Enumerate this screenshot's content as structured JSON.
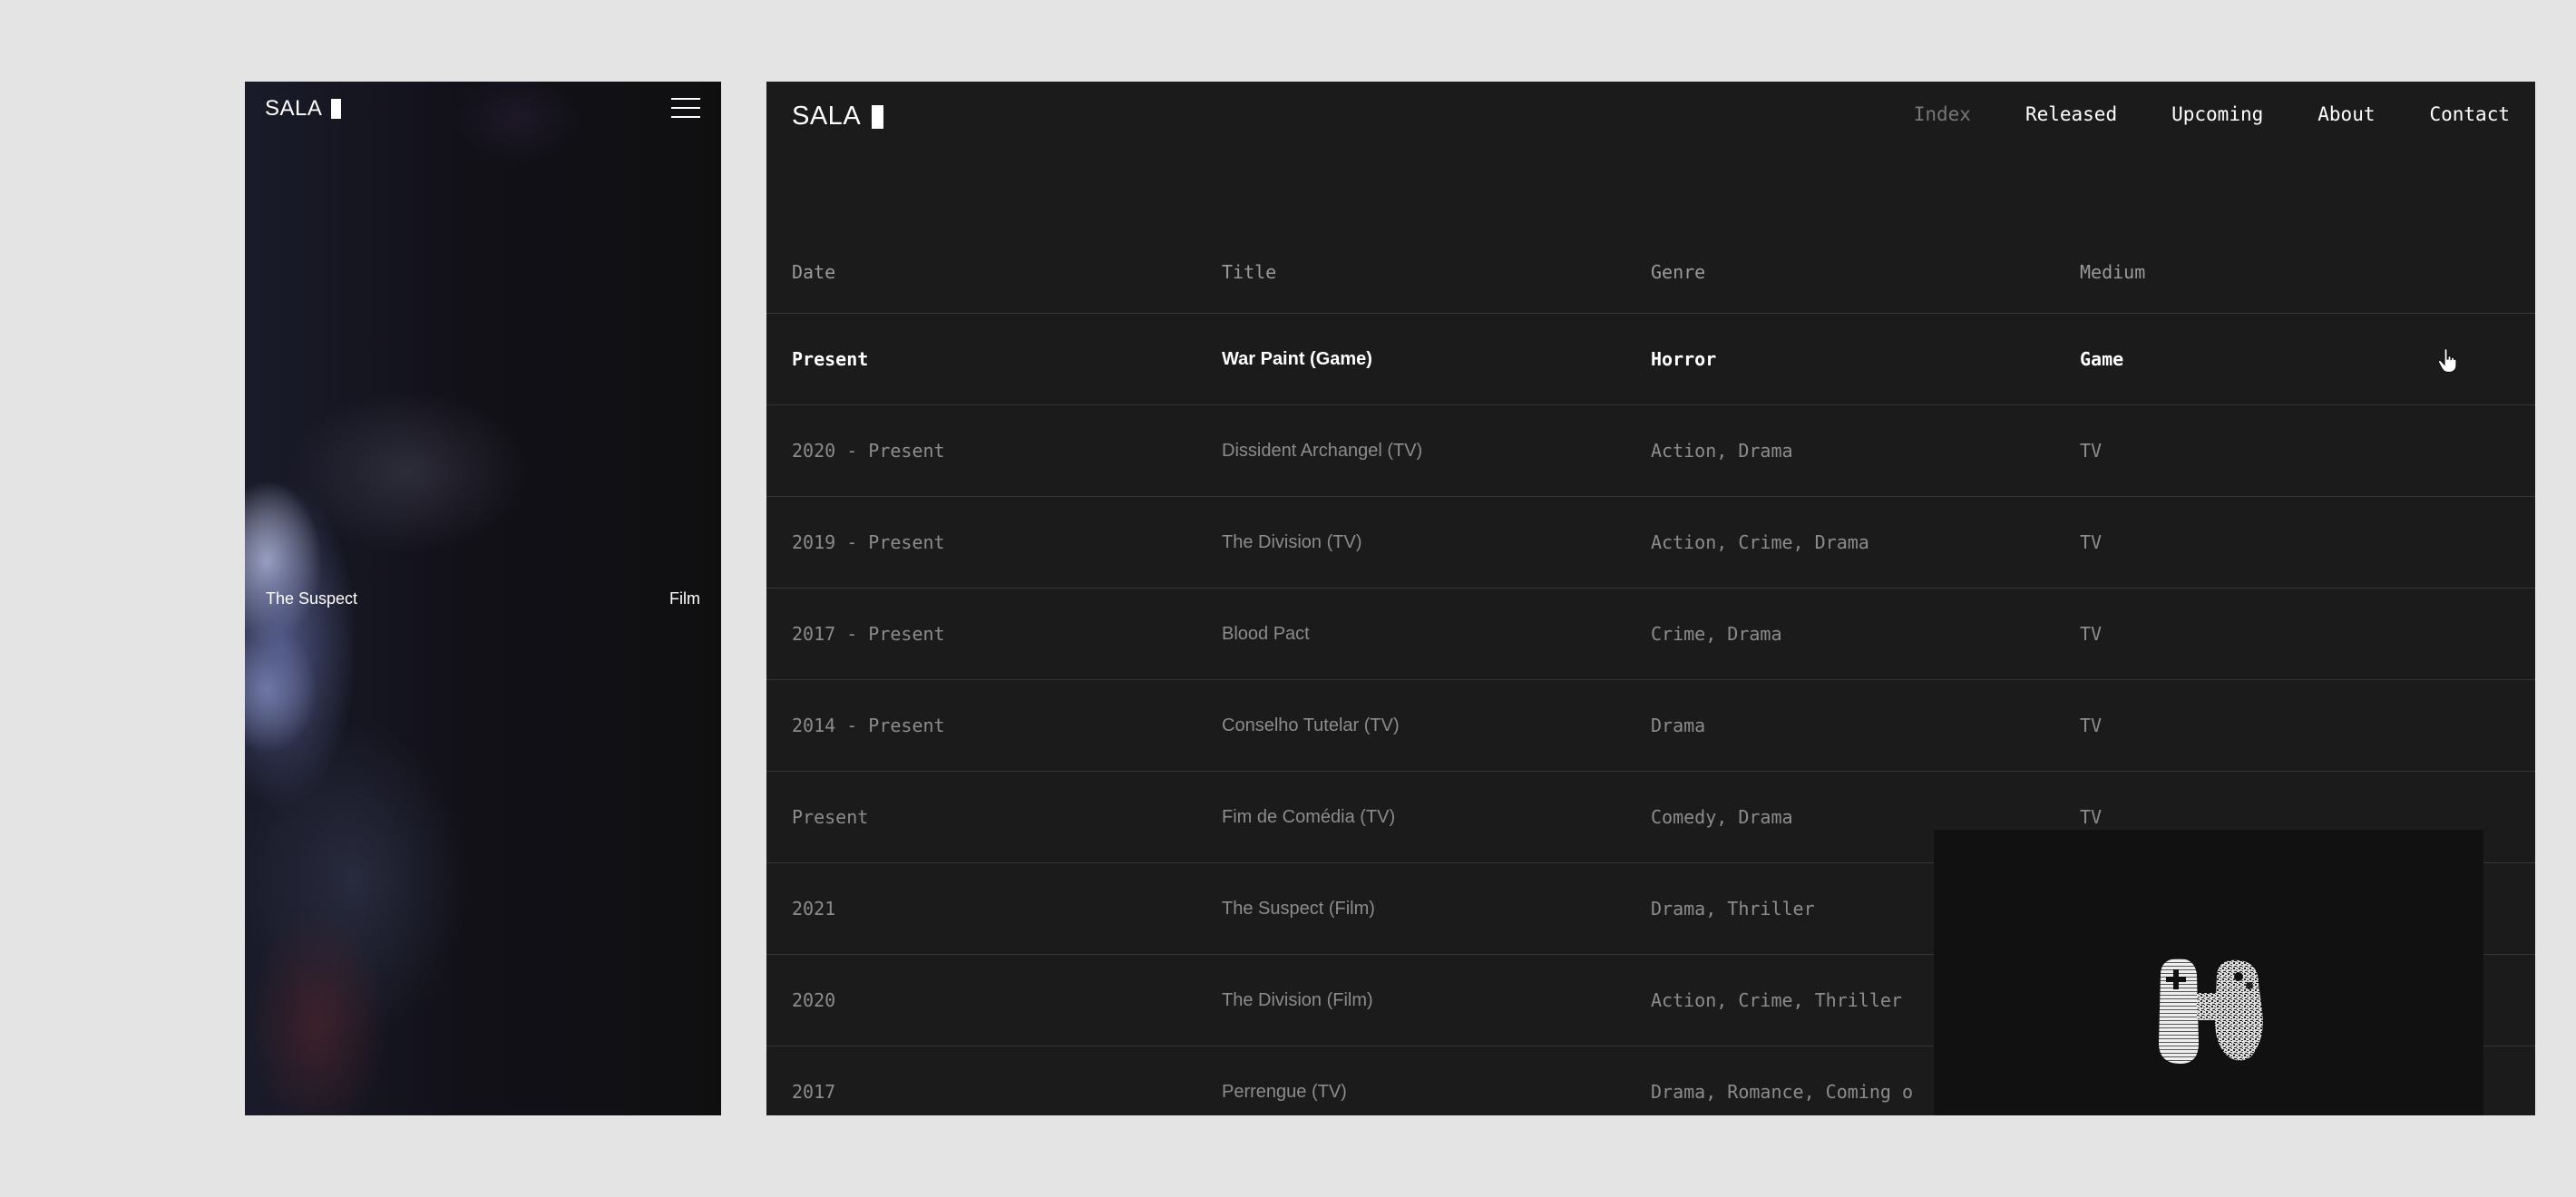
{
  "mobile": {
    "logo": "SALA",
    "caption": {
      "title": "The Suspect",
      "medium": "Film"
    }
  },
  "desktop": {
    "logo": "SALA",
    "nav": [
      {
        "label": "Index",
        "active": true
      },
      {
        "label": "Released",
        "active": false
      },
      {
        "label": "Upcoming",
        "active": false
      },
      {
        "label": "About",
        "active": false
      },
      {
        "label": "Contact",
        "active": false
      }
    ],
    "table": {
      "headers": {
        "date": "Date",
        "title": "Title",
        "genre": "Genre",
        "medium": "Medium"
      },
      "rows": [
        {
          "date": "Present",
          "title": "War Paint (Game)",
          "genre": "Horror",
          "medium": "Game",
          "highlight": true
        },
        {
          "date": "2020 - Present",
          "title": "Dissident Archangel (TV)",
          "genre": "Action, Drama",
          "medium": "TV"
        },
        {
          "date": "2019 - Present",
          "title": "The Division (TV)",
          "genre": "Action, Crime, Drama",
          "medium": "TV"
        },
        {
          "date": "2017 - Present",
          "title": "Blood Pact",
          "genre": "Crime, Drama",
          "medium": "TV"
        },
        {
          "date": "2014 - Present",
          "title": "Conselho Tutelar (TV)",
          "genre": "Drama",
          "medium": "TV"
        },
        {
          "date": "Present",
          "title": "Fim de Comédia (TV)",
          "genre": "Comedy, Drama",
          "medium": "TV"
        },
        {
          "date": "2021",
          "title": "The Suspect (Film)",
          "genre": "Drama, Thriller",
          "medium": ""
        },
        {
          "date": "2020",
          "title": "The Division (Film)",
          "genre": "Action, Crime, Thriller",
          "medium": ""
        },
        {
          "date": "2017",
          "title": "Perrengue (TV)",
          "genre": "Drama, Romance, Coming o",
          "medium": ""
        }
      ]
    },
    "colors": {
      "background": "#1b1b1b",
      "text": "#ffffff",
      "muted": "#8c8c8c",
      "nav_active": "#777777"
    }
  }
}
